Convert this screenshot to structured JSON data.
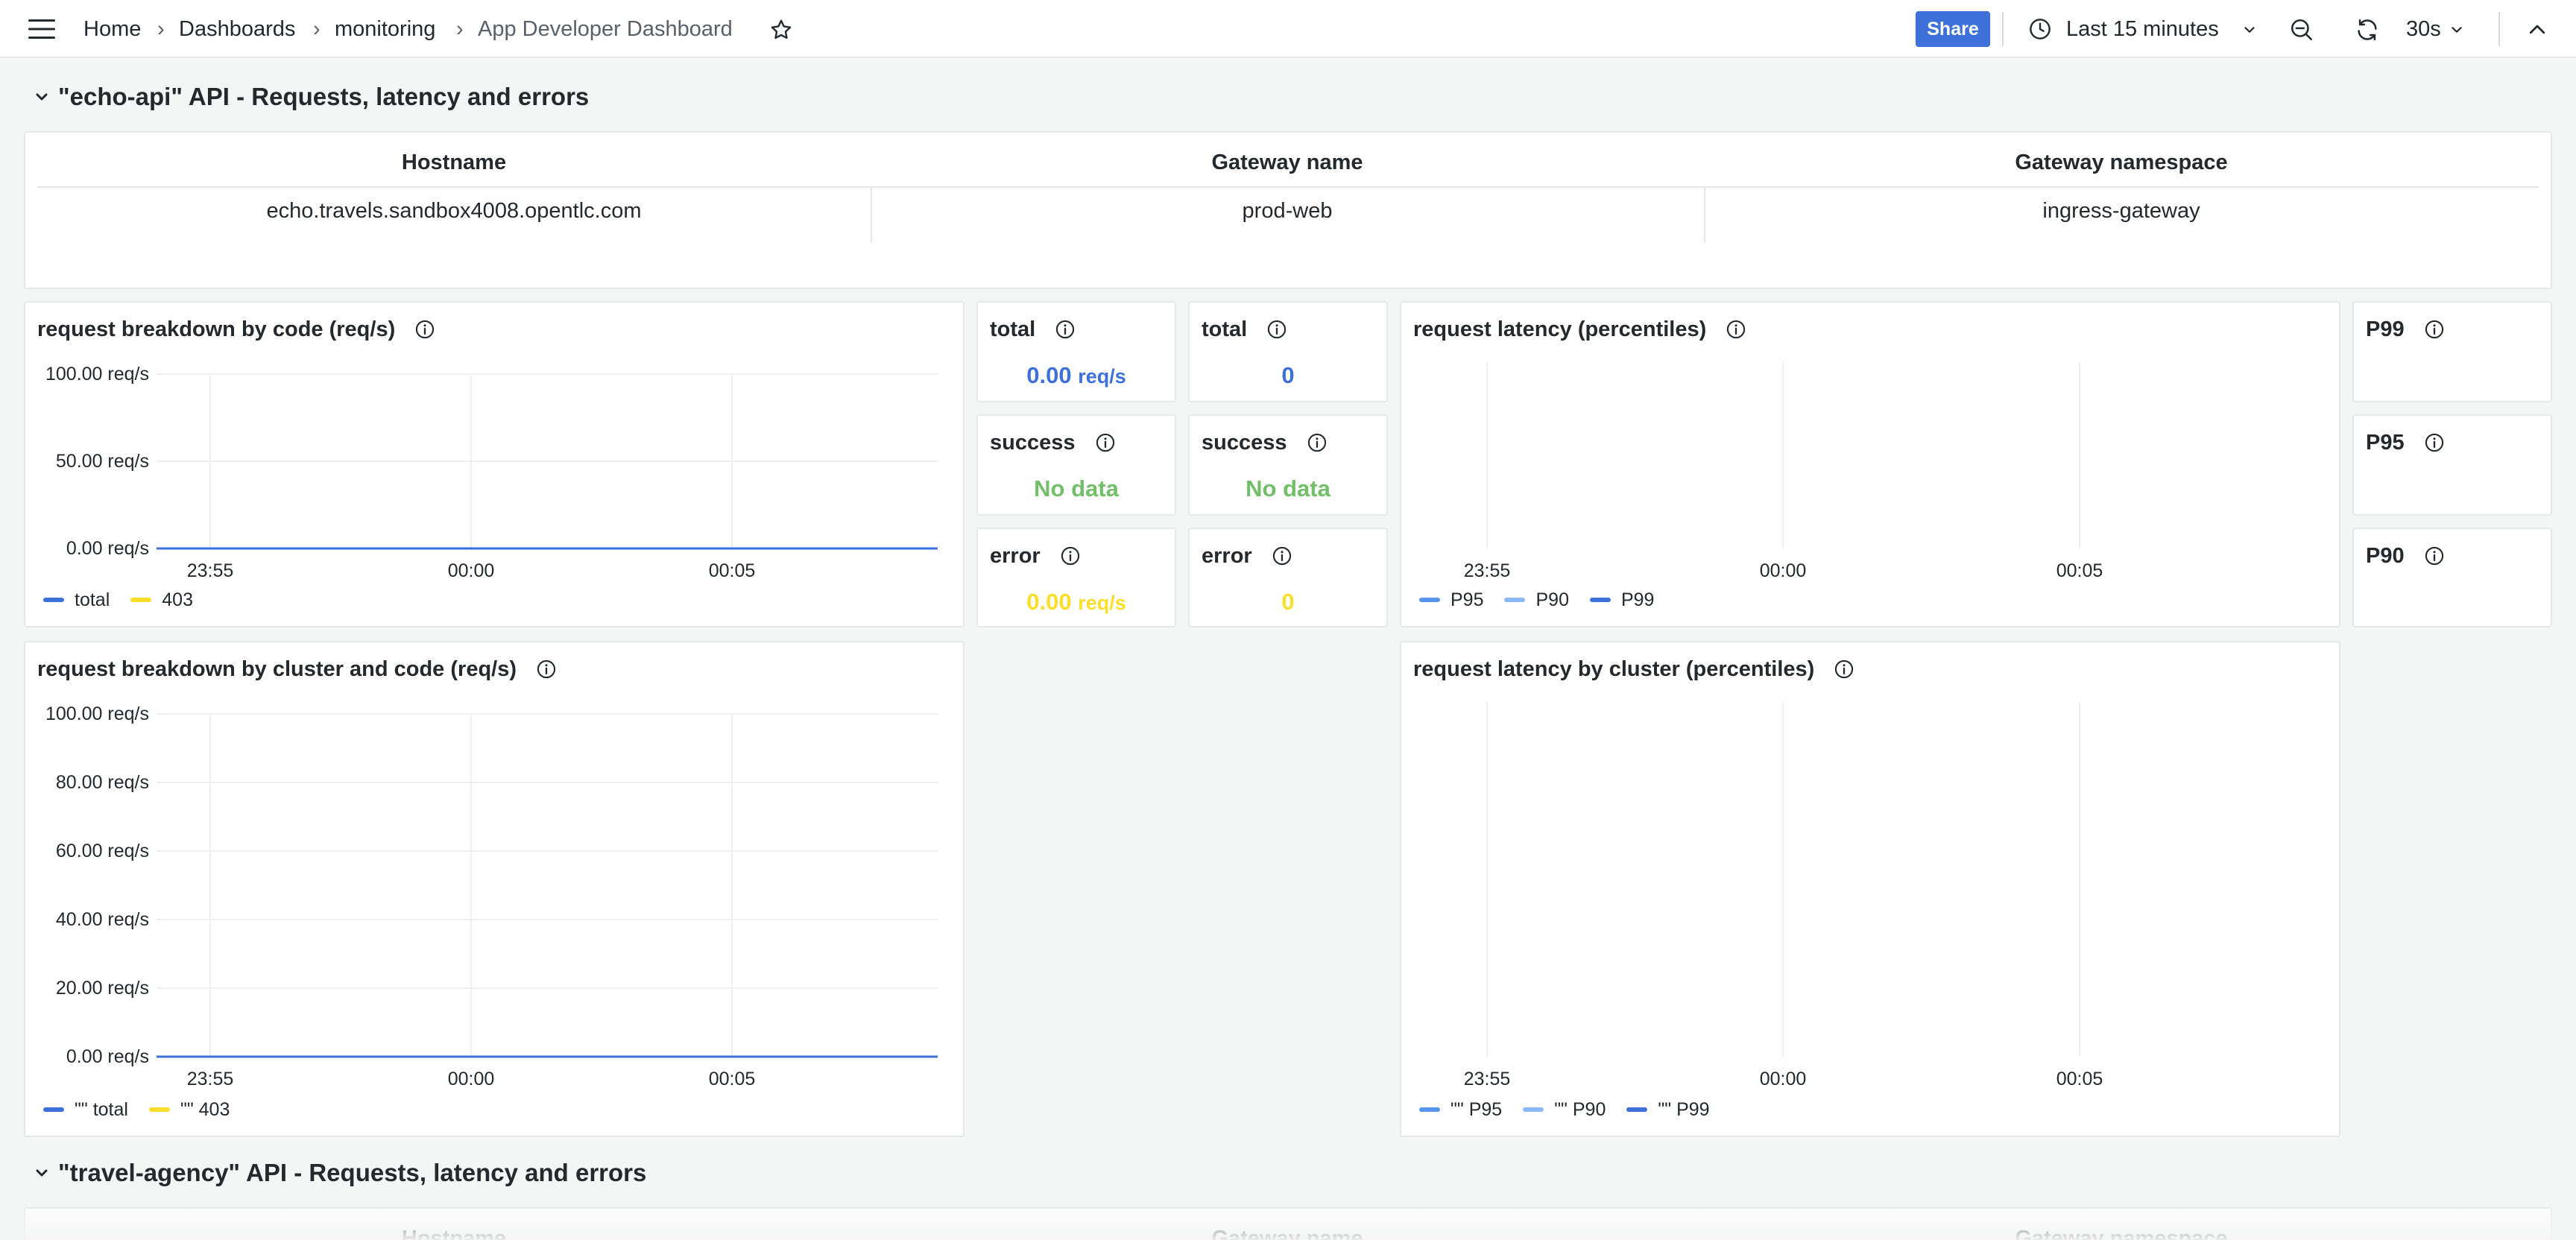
{
  "topbar": {
    "breadcrumbs": [
      "Home",
      "Dashboards",
      "monitoring",
      "App Developer Dashboard"
    ],
    "separator": "›",
    "share_label": "Share",
    "time_range": "Last 15 minutes",
    "refresh_interval": "30s",
    "icons": [
      "menu-icon",
      "star-icon",
      "clock-icon",
      "chevron-down-icon",
      "zoom-out-icon",
      "refresh-icon",
      "collapse-up-icon"
    ]
  },
  "rows": [
    {
      "title": "\"echo-api\" API - Requests, latency and errors"
    },
    {
      "title": "\"travel-agency\" API - Requests, latency and errors"
    }
  ],
  "echo_table": {
    "headers": [
      "Hostname",
      "Gateway name",
      "Gateway namespace"
    ],
    "values": [
      "echo.travels.sandbox4008.opentlc.com",
      "prod-web",
      "ingress-gateway"
    ]
  },
  "travel_table": {
    "headers": [
      "Hostname",
      "Gateway name",
      "Gateway namespace"
    ]
  },
  "stats": [
    {
      "title": "total",
      "value": "0.00",
      "unit": "req/s",
      "color": "#3d71d9"
    },
    {
      "title": "total",
      "value": "0",
      "unit": "",
      "color": "#3d71d9"
    },
    {
      "title": "success",
      "value": "No data",
      "unit": "",
      "color": "#73bf69"
    },
    {
      "title": "success",
      "value": "No data",
      "unit": "",
      "color": "#73bf69"
    },
    {
      "title": "error",
      "value": "0.00",
      "unit": "req/s",
      "color": "#fade2a"
    },
    {
      "title": "error",
      "value": "0",
      "unit": "",
      "color": "#fade2a"
    }
  ],
  "percentile_stats": [
    "P99",
    "P95",
    "P90"
  ],
  "chart_data": [
    {
      "type": "line",
      "title": "request breakdown by code (req/s)",
      "x": [
        "23:55",
        "00:00",
        "00:05"
      ],
      "ytick_labels": [
        "100.00 req/s",
        "50.00 req/s",
        "0.00 req/s"
      ],
      "ylim": [
        0,
        100
      ],
      "series": [
        {
          "name": "total",
          "color": "#3d71d9",
          "values": [
            0,
            0,
            0
          ]
        },
        {
          "name": "403",
          "color": "#fade2a",
          "values": [
            0,
            0,
            0
          ]
        }
      ],
      "legend": "bottom-left"
    },
    {
      "type": "line",
      "title": "request latency (percentiles)",
      "x": [
        "23:55",
        "00:00",
        "00:05"
      ],
      "ytick_labels": [],
      "series": [
        {
          "name": "P95",
          "color": "#5794f2",
          "values": []
        },
        {
          "name": "P90",
          "color": "#8ab8ff",
          "values": []
        },
        {
          "name": "P99",
          "color": "#3d71d9",
          "values": []
        }
      ],
      "legend": "bottom-left"
    },
    {
      "type": "line",
      "title": "request breakdown by cluster and code (req/s)",
      "x": [
        "23:55",
        "00:00",
        "00:05"
      ],
      "ytick_labels": [
        "100.00 req/s",
        "80.00 req/s",
        "60.00 req/s",
        "40.00 req/s",
        "20.00 req/s",
        "0.00 req/s"
      ],
      "ylim": [
        0,
        100
      ],
      "series": [
        {
          "name": "\"\" total",
          "color": "#3d71d9",
          "values": [
            0,
            0,
            0
          ]
        },
        {
          "name": "\"\" 403",
          "color": "#fade2a",
          "values": [
            0,
            0,
            0
          ]
        }
      ],
      "legend": "bottom-left"
    },
    {
      "type": "line",
      "title": "request latency by cluster (percentiles)",
      "x": [
        "23:55",
        "00:00",
        "00:05"
      ],
      "ytick_labels": [],
      "series": [
        {
          "name": "\"\" P95",
          "color": "#5794f2",
          "values": []
        },
        {
          "name": "\"\" P90",
          "color": "#8ab8ff",
          "values": []
        },
        {
          "name": "\"\" P99",
          "color": "#3d71d9",
          "values": []
        }
      ],
      "legend": "bottom-left"
    }
  ]
}
